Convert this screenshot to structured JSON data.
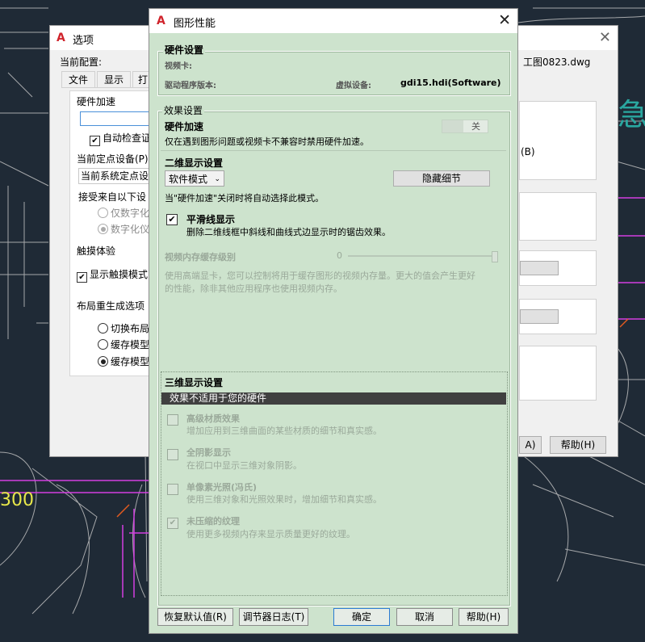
{
  "cad": {
    "dimension_text": "300",
    "right_glyph": "急"
  },
  "back_dialog": {
    "title": "选项",
    "current_config_label": "当前配置:",
    "current_drawing": "工图0823.dwg",
    "tabs": [
      "文件",
      "显示",
      "打"
    ],
    "hardware_accel_title": "硬件加速",
    "auto_check_label": "自动检查证",
    "pointing_device_title": "当前定点设备(P)",
    "pointing_device_value": "当前系统定点设",
    "accept_from_label": "接受来自以下设",
    "radio_digitizer_only": "仅数字化",
    "radio_digitizer_and": "数字化仪",
    "touch_title": "触摸体验",
    "touch_checkbox": "显示触摸模式",
    "layout_regen_title": "布局重生成选项",
    "regen_options": [
      "切换布局",
      "缓存模型",
      "缓存模型"
    ],
    "right_fragment": "(B)",
    "apply_fragment": "A)",
    "help_button": "帮助(H)"
  },
  "front_dialog": {
    "title": "图形性能",
    "hardware_settings_title": "硬件设置",
    "video_card_label": "视频卡:",
    "driver_version_label": "驱动程序版本:",
    "virtual_device_label": "虚拟设备:",
    "virtual_device_value": "gdi15.hdi(Software)",
    "effect_settings_title": "效果设置",
    "hw_accel_title": "硬件加速",
    "hw_accel_desc": "仅在遇到图形问题或视频卡不兼容时禁用硬件加速。",
    "hw_accel_toggle": "关",
    "display2d_title": "二维显示设置",
    "mode_select": "软件模式",
    "hide_details_button": "隐藏细节",
    "auto_mode_note": "当\"硬件加速\"关闭时将自动选择此模式。",
    "smooth_line_title": "平滑线显示",
    "smooth_line_desc": "删除二维线框中斜线和曲线式边显示时的锯齿效果。",
    "video_cache_title": "视频内存缓存级别",
    "video_cache_value": "0",
    "video_cache_level": 1.0,
    "video_cache_desc_1": "使用高端显卡，您可以控制将用于缓存图形的视频内存量。更大的值会产生更好",
    "video_cache_desc_2": "的性能，除非其他应用程序也使用视频内存。",
    "display3d_title": "三维显示设置",
    "not_applicable_bar": "效果不适用于您的硬件",
    "effects_3d": [
      {
        "title": "高级材质效果",
        "desc": "增加应用到三维曲面的某些材质的细节和真实感。",
        "checked": false
      },
      {
        "title": "全阴影显示",
        "desc": "在视口中显示三维对象阴影。",
        "checked": false
      },
      {
        "title": "单像素光照(冯氏)",
        "desc": "使用三维对象和光照效果时，增加细节和真实感。",
        "checked": false
      },
      {
        "title": "未压缩的纹理",
        "desc": "使用更多视频内存来显示质量更好的纹理。",
        "checked": true
      }
    ],
    "buttons": {
      "restore_defaults": "恢复默认值(R)",
      "tuner_log": "调节器日志(T)",
      "ok": "确定",
      "cancel": "取消",
      "help": "帮助(H)"
    }
  }
}
